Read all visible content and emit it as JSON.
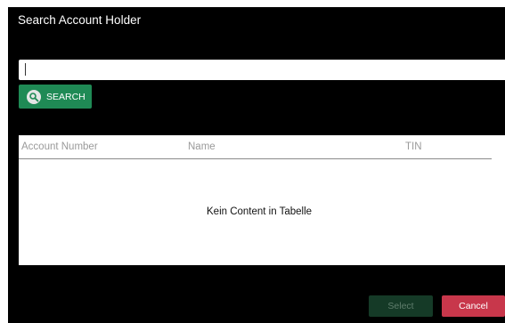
{
  "dialog": {
    "title": "Search Account Holder"
  },
  "search": {
    "value": "",
    "button_label": "SEARCH",
    "icon": "search-icon"
  },
  "table": {
    "columns": [
      "Account Number",
      "Name",
      "TIN"
    ],
    "rows": [],
    "empty_message": "Kein Content in Tabelle"
  },
  "footer": {
    "select_label": "Select",
    "select_enabled": false,
    "cancel_label": "Cancel"
  },
  "colors": {
    "dialog_background": "#000000",
    "search_button": "#1f8a55",
    "select_button_disabled": "#153a27",
    "cancel_button": "#c8374b"
  }
}
